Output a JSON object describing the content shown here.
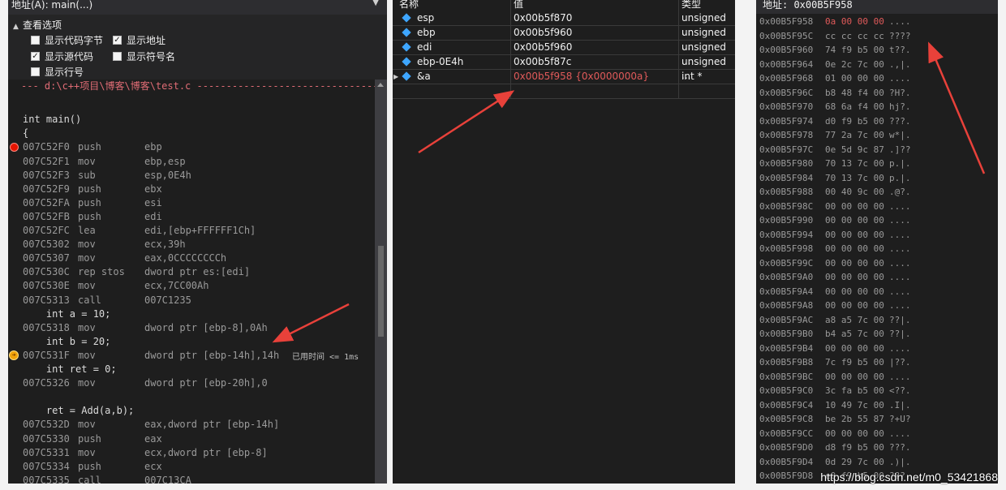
{
  "disassembly": {
    "address_label": "地址(A): main(...)",
    "options_header": "查看选项",
    "options": [
      {
        "label": "显示代码字节",
        "checked": false
      },
      {
        "label": "显示地址",
        "checked": true
      },
      {
        "label": "显示源代码",
        "checked": true
      },
      {
        "label": "显示符号名",
        "checked": false
      },
      {
        "label": "显示行号",
        "checked": false
      }
    ],
    "file_line": "--- d:\\c++项目\\博客\\博客\\test.c ---------------------------------",
    "elapsed": "已用时间 <= 1ms",
    "lines": [
      {
        "kind": "blank"
      },
      {
        "kind": "src",
        "text": "int main()"
      },
      {
        "kind": "src",
        "text": "{"
      },
      {
        "kind": "asm",
        "addr": "007C52F0",
        "op": "push",
        "arg": "ebp",
        "mark": "breakpoint"
      },
      {
        "kind": "asm",
        "addr": "007C52F1",
        "op": "mov",
        "arg": "ebp,esp"
      },
      {
        "kind": "asm",
        "addr": "007C52F3",
        "op": "sub",
        "arg": "esp,0E4h"
      },
      {
        "kind": "asm",
        "addr": "007C52F9",
        "op": "push",
        "arg": "ebx"
      },
      {
        "kind": "asm",
        "addr": "007C52FA",
        "op": "push",
        "arg": "esi"
      },
      {
        "kind": "asm",
        "addr": "007C52FB",
        "op": "push",
        "arg": "edi"
      },
      {
        "kind": "asm",
        "addr": "007C52FC",
        "op": "lea",
        "arg": "edi,[ebp+FFFFFF1Ch]"
      },
      {
        "kind": "asm",
        "addr": "007C5302",
        "op": "mov",
        "arg": "ecx,39h"
      },
      {
        "kind": "asm",
        "addr": "007C5307",
        "op": "mov",
        "arg": "eax,0CCCCCCCCh"
      },
      {
        "kind": "asm",
        "addr": "007C530C",
        "op": "rep stos",
        "arg": "dword ptr es:[edi]"
      },
      {
        "kind": "asm",
        "addr": "007C530E",
        "op": "mov",
        "arg": "ecx,7CC00Ah"
      },
      {
        "kind": "asm",
        "addr": "007C5313",
        "op": "call",
        "arg": "007C1235"
      },
      {
        "kind": "src",
        "text": "    int a = 10;"
      },
      {
        "kind": "asm",
        "addr": "007C5318",
        "op": "mov",
        "arg": "dword ptr [ebp-8],0Ah"
      },
      {
        "kind": "src",
        "text": "    int b = 20;"
      },
      {
        "kind": "asm",
        "addr": "007C531F",
        "op": "mov",
        "arg": "dword ptr [ebp-14h],14h",
        "mark": "current"
      },
      {
        "kind": "src",
        "text": "    int ret = 0;"
      },
      {
        "kind": "asm",
        "addr": "007C5326",
        "op": "mov",
        "arg": "dword ptr [ebp-20h],0"
      },
      {
        "kind": "blank"
      },
      {
        "kind": "src",
        "text": "    ret = Add(a,b);"
      },
      {
        "kind": "asm",
        "addr": "007C532D",
        "op": "mov",
        "arg": "eax,dword ptr [ebp-14h]"
      },
      {
        "kind": "asm",
        "addr": "007C5330",
        "op": "push",
        "arg": "eax"
      },
      {
        "kind": "asm",
        "addr": "007C5331",
        "op": "mov",
        "arg": "ecx,dword ptr [ebp-8]"
      },
      {
        "kind": "asm",
        "addr": "007C5334",
        "op": "push",
        "arg": "ecx"
      },
      {
        "kind": "asm",
        "addr": "007C5335",
        "op": "call",
        "arg": "007C13CA"
      }
    ]
  },
  "watch": {
    "headers": {
      "name": "名称",
      "value": "值",
      "type": "类型"
    },
    "rows": [
      {
        "name": "esp",
        "value": "0x00b5f870",
        "type": "unsigned ...",
        "expandable": false,
        "changed": false
      },
      {
        "name": "ebp",
        "value": "0x00b5f960",
        "type": "unsigned ...",
        "expandable": false,
        "changed": false
      },
      {
        "name": "edi",
        "value": "0x00b5f960",
        "type": "unsigned ...",
        "expandable": false,
        "changed": false
      },
      {
        "name": "ebp-0E4h",
        "value": "0x00b5f87c",
        "type": "unsigned ...",
        "expandable": false,
        "changed": false
      },
      {
        "name": "&a",
        "value": "0x00b5f958 {0x0000000a}",
        "type": "int *",
        "expandable": true,
        "changed": true
      }
    ],
    "changed_color": "#e05a5a"
  },
  "memory": {
    "address_label": "地址: 0x00B5F958",
    "rows": [
      {
        "addr": "0x00B5F958",
        "hex": "0a 00 00 00",
        "ascii": "....",
        "changed": true
      },
      {
        "addr": "0x00B5F95C",
        "hex": "cc cc cc cc",
        "ascii": "????"
      },
      {
        "addr": "0x00B5F960",
        "hex": "74 f9 b5 00",
        "ascii": "t??."
      },
      {
        "addr": "0x00B5F964",
        "hex": "0e 2c 7c 00",
        "ascii": ".,|."
      },
      {
        "addr": "0x00B5F968",
        "hex": "01 00 00 00",
        "ascii": "...."
      },
      {
        "addr": "0x00B5F96C",
        "hex": "b8 48 f4 00",
        "ascii": "?H?."
      },
      {
        "addr": "0x00B5F970",
        "hex": "68 6a f4 00",
        "ascii": "hj?."
      },
      {
        "addr": "0x00B5F974",
        "hex": "d0 f9 b5 00",
        "ascii": "???."
      },
      {
        "addr": "0x00B5F978",
        "hex": "77 2a 7c 00",
        "ascii": "w*|."
      },
      {
        "addr": "0x00B5F97C",
        "hex": "0e 5d 9c 87",
        "ascii": ".]??"
      },
      {
        "addr": "0x00B5F980",
        "hex": "70 13 7c 00",
        "ascii": "p.|."
      },
      {
        "addr": "0x00B5F984",
        "hex": "70 13 7c 00",
        "ascii": "p.|."
      },
      {
        "addr": "0x00B5F988",
        "hex": "00 40 9c 00",
        "ascii": ".@?."
      },
      {
        "addr": "0x00B5F98C",
        "hex": "00 00 00 00",
        "ascii": "...."
      },
      {
        "addr": "0x00B5F990",
        "hex": "00 00 00 00",
        "ascii": "...."
      },
      {
        "addr": "0x00B5F994",
        "hex": "00 00 00 00",
        "ascii": "...."
      },
      {
        "addr": "0x00B5F998",
        "hex": "00 00 00 00",
        "ascii": "...."
      },
      {
        "addr": "0x00B5F99C",
        "hex": "00 00 00 00",
        "ascii": "...."
      },
      {
        "addr": "0x00B5F9A0",
        "hex": "00 00 00 00",
        "ascii": "...."
      },
      {
        "addr": "0x00B5F9A4",
        "hex": "00 00 00 00",
        "ascii": "...."
      },
      {
        "addr": "0x00B5F9A8",
        "hex": "00 00 00 00",
        "ascii": "...."
      },
      {
        "addr": "0x00B5F9AC",
        "hex": "a8 a5 7c 00",
        "ascii": "??|."
      },
      {
        "addr": "0x00B5F9B0",
        "hex": "b4 a5 7c 00",
        "ascii": "??|."
      },
      {
        "addr": "0x00B5F9B4",
        "hex": "00 00 00 00",
        "ascii": "...."
      },
      {
        "addr": "0x00B5F9B8",
        "hex": "7c f9 b5 00",
        "ascii": "|??."
      },
      {
        "addr": "0x00B5F9BC",
        "hex": "00 00 00 00",
        "ascii": "...."
      },
      {
        "addr": "0x00B5F9C0",
        "hex": "3c fa b5 00",
        "ascii": "<??."
      },
      {
        "addr": "0x00B5F9C4",
        "hex": "10 49 7c 00",
        "ascii": ".I|."
      },
      {
        "addr": "0x00B5F9C8",
        "hex": "be 2b 55 87",
        "ascii": "?+U?"
      },
      {
        "addr": "0x00B5F9CC",
        "hex": "00 00 00 00",
        "ascii": "...."
      },
      {
        "addr": "0x00B5F9D0",
        "hex": "d8 f9 b5 00",
        "ascii": "???."
      },
      {
        "addr": "0x00B5F9D4",
        "hex": "0d 29 7c 00",
        "ascii": ".)|."
      },
      {
        "addr": "0x00B5F9D8",
        "hex": "e0 f9 b5 00",
        "ascii": "???."
      }
    ]
  },
  "watermark": "https://blog.csdn.net/m0_53421868",
  "colors": {
    "arrow": "#e8413a",
    "breakpoint": "#e51400",
    "instruction_pointer": "#f0a30a"
  }
}
